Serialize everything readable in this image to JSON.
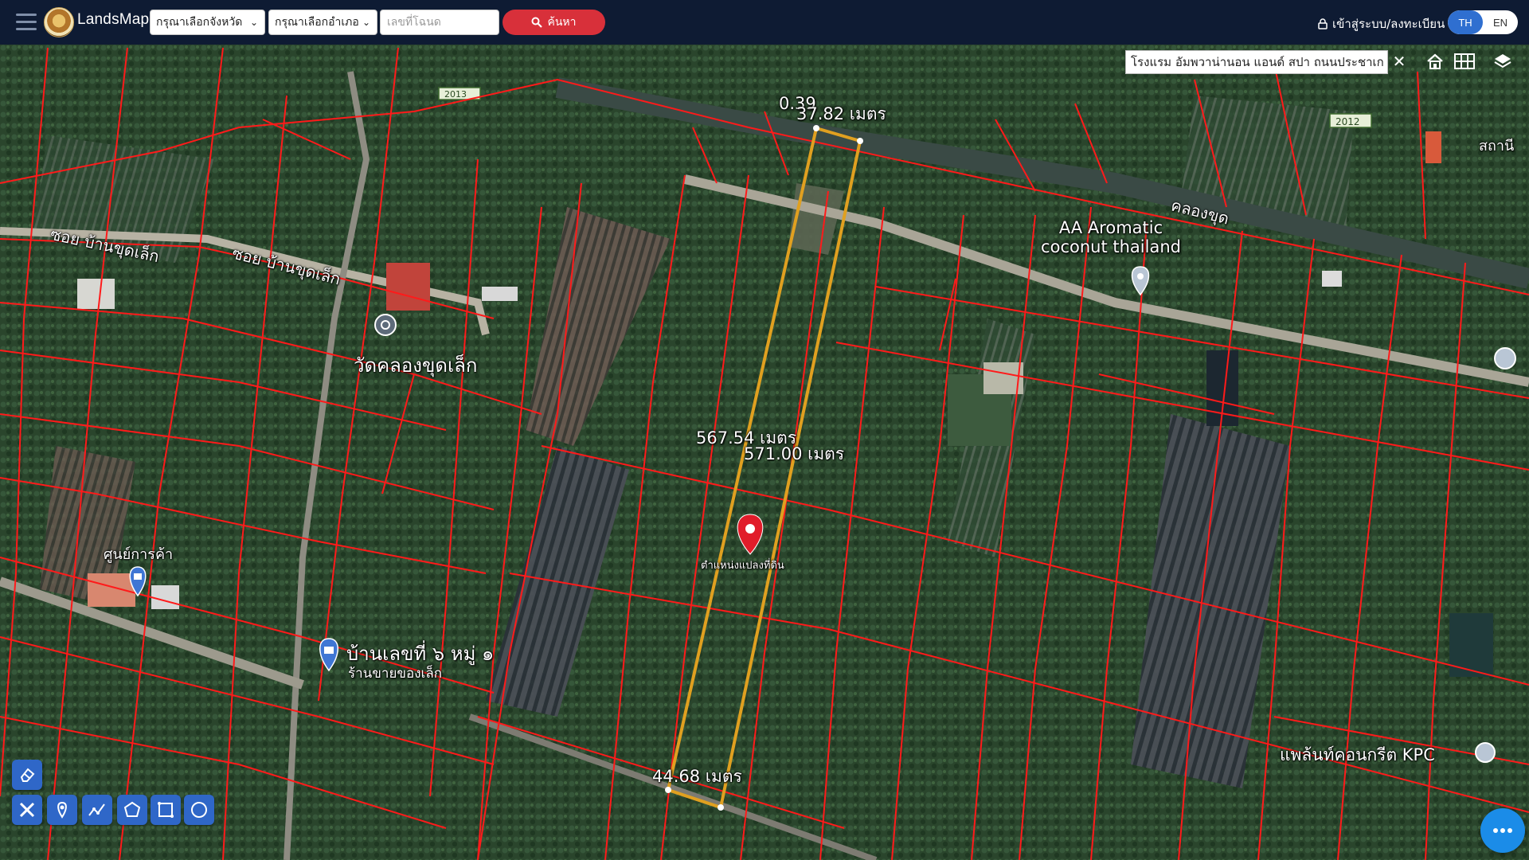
{
  "app": {
    "name": "LandsMaps"
  },
  "header": {
    "province_select": "กรุณาเลือกจังหวัด",
    "district_select": "กรุณาเลือกอำเภอ",
    "deed_placeholder": "เลขที่โฉนด",
    "search_label": "ค้นหา",
    "login_label": "เข้าสู่ระบบ/ลงทะเบียน",
    "lang_th": "TH",
    "lang_en": "EN"
  },
  "map_search": {
    "value": "โรงแรม อัมพวาน่านอน แอนด์ สปา ถนนประชาเก"
  },
  "map_labels": {
    "road_2013": "2013",
    "road_2012": "2012",
    "soi_1": "ซอย บ้านขุดเล็ก",
    "soi_2": "ซอย บ้านขุดเล็ก",
    "temple": "วัดคลองขุดเล็ก",
    "canal": "คลองขุด",
    "aa_aromatic": "AA Aromatic coconut thailand",
    "shop_center": "ศูนย์การค้า",
    "house_no": "บ้านเลขที่ ๖ หมู่ ๑",
    "small_shop": "ร้านขายของเล็ก",
    "concrete_plant": "แพล้นท์คอนกรีต KPC",
    "corner_top": "สถานี",
    "marker_label": "ตำแหน่งแปลงที่ดิน"
  },
  "measurements": {
    "top_small": "0.39",
    "top": "37.82 เมตร",
    "left": "567.54 เมตร",
    "right": "571.00 เมตร",
    "bottom": "44.68 เมตร"
  },
  "colors": {
    "topbar": "#0e1b33",
    "parcel_line": "#ff1a1a",
    "measure_line": "#e0a020",
    "search_button": "#d8303a",
    "tool_button": "#2f67c8"
  }
}
